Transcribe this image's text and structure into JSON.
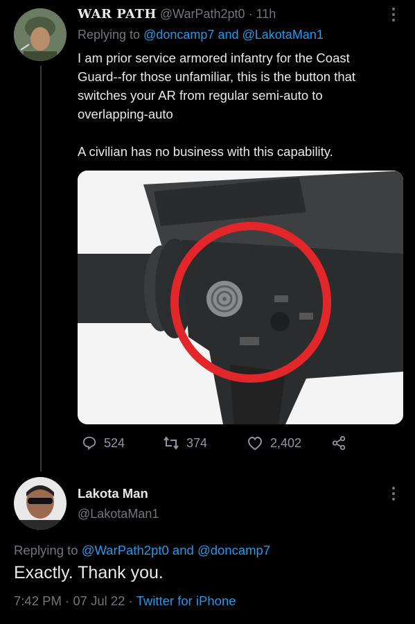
{
  "tweet1": {
    "display_name": "WAR PATH",
    "handle": "@WarPath2pt0",
    "sep": "·",
    "time": "11h",
    "replying_prefix": "Replying to",
    "replying_to_1": "@doncamp7",
    "replying_and": "and",
    "replying_to_2": "@LakotaMan1",
    "body_line1": "I am prior service armored infantry for the Coast",
    "body_line2": "Guard--for those unfamiliar, this is the button that",
    "body_line3": "switches your AR from regular semi-auto to",
    "body_line4": "overlapping-auto",
    "body_line5": "A civilian has no business with this capability.",
    "replies": "524",
    "retweets": "374",
    "likes": "2,402"
  },
  "tweet2": {
    "display_name": "Lakota Man",
    "handle": "@LakotaMan1",
    "replying_prefix": "Replying to",
    "replying_to_1": "@WarPath2pt0",
    "replying_and": "and",
    "replying_to_2": "@doncamp7",
    "body": "Exactly. Thank you.",
    "time": "7:42 PM",
    "sep1": "·",
    "date": "07 Jul 22",
    "sep2": "·",
    "source": "Twitter for iPhone"
  },
  "colors": {
    "background": "#000000",
    "text": "#e7e9ea",
    "muted": "#71767b",
    "link": "#1d9bf0",
    "highlight_circle": "#e3262a"
  },
  "icons": [
    "more-icon",
    "reply-icon",
    "retweet-icon",
    "like-icon",
    "share-icon"
  ]
}
